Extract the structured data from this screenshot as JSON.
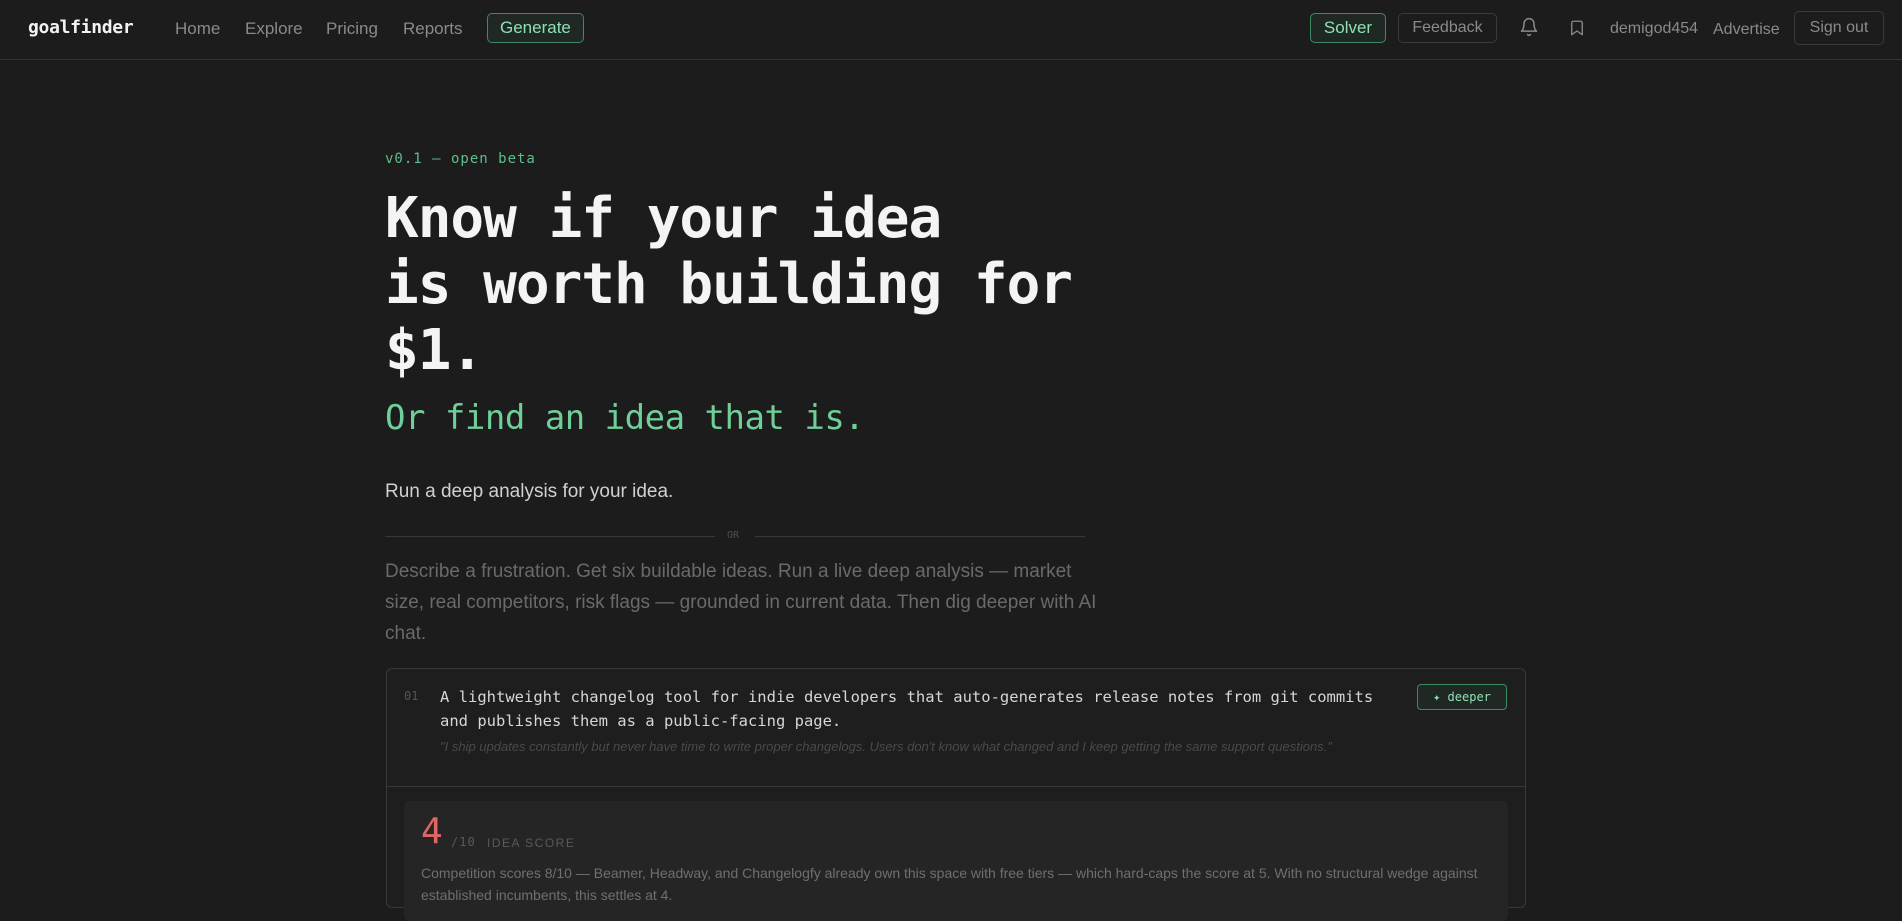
{
  "nav": {
    "logo": "goalfinder",
    "links": [
      "Home",
      "Explore",
      "Pricing",
      "Reports"
    ],
    "generate_label": "Generate",
    "solver_label": "Solver",
    "feedback_label": "Feedback",
    "username": "demigod454",
    "advertise_label": "Advertise",
    "signout_label": "Sign out",
    "icons": [
      "bell-icon",
      "bookmark-icon"
    ]
  },
  "hero": {
    "badge": "v0.1 — open beta",
    "headline_lines": [
      "Know if your idea",
      "is worth building for",
      "$1."
    ],
    "subheadline": "Or find an idea that is.",
    "cta_text": "Run a deep analysis for your idea.",
    "divider_label": "OR",
    "description": "Describe a frustration. Get six buildable ideas. Run a live deep analysis — market size, real competitors, risk flags — grounded in current data. Then dig deeper with AI chat."
  },
  "idea_card": {
    "number": "01",
    "idea": "A lightweight changelog tool for indie developers that auto-generates release notes from git commits and publishes them as a public-facing page.",
    "quote": "\"I ship updates constantly but never have time to write proper changelogs. Users don't know what changed and I keep getting the same support questions.\"",
    "deeper_label": "✦ deeper",
    "score": {
      "value": "4",
      "denominator": "/10",
      "label": "IDEA SCORE",
      "text": "Competition scores 8/10 — Beamer, Headway, and Changelogfy already own this space with free tiers — which hard-caps the score at 5. With no structural wedge against established incumbents, this settles at 4."
    }
  },
  "colors": {
    "background": "#1c1c1c",
    "accent_green": "#6fcf98",
    "score_red": "#e06666"
  }
}
